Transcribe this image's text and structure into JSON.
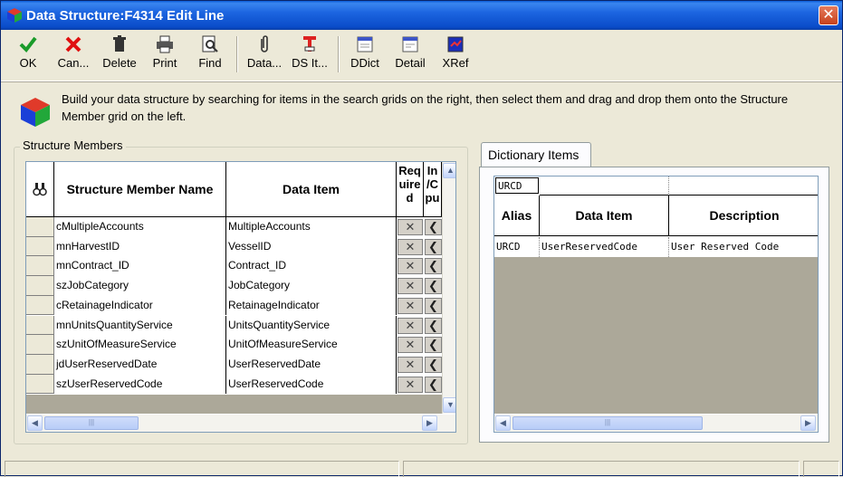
{
  "window": {
    "title": "Data Structure:F4314 Edit Line",
    "close_glyph": "✕"
  },
  "toolbar": {
    "ok": "OK",
    "cancel": "Can...",
    "delete": "Delete",
    "print": "Print",
    "find": "Find",
    "data": "Data...",
    "ds_item": "DS It...",
    "ddict": "DDict",
    "detail": "Detail",
    "xref": "XRef"
  },
  "info": {
    "message": "Build your data structure by searching for items in the search grids on the right, then select them and drag and drop them onto the Structure Member grid on the left."
  },
  "structure_members": {
    "group_label": "Structure Members",
    "headers": {
      "member_name": "Structure Member Name",
      "data_item": "Data Item",
      "required": "Req uire d",
      "io": "In /C pu"
    },
    "rows": [
      {
        "name": "cMultipleAccounts",
        "item": "MultipleAccounts"
      },
      {
        "name": "mnHarvestID",
        "item": "VesselID"
      },
      {
        "name": "mnContract_ID",
        "item": "Contract_ID"
      },
      {
        "name": "szJobCategory",
        "item": "JobCategory"
      },
      {
        "name": "cRetainageIndicator",
        "item": "RetainageIndicator"
      },
      {
        "name": "mnUnitsQuantityService",
        "item": "UnitsQuantityService"
      },
      {
        "name": "szUnitOfMeasureService",
        "item": "UnitOfMeasureService"
      },
      {
        "name": "jdUserReservedDate",
        "item": "UserReservedDate"
      },
      {
        "name": "szUserReservedCode",
        "item": "UserReservedCode"
      }
    ],
    "req_glyph": "✕"
  },
  "dictionary_items": {
    "tab_label": "Dictionary Items",
    "search_value": "URCD",
    "headers": {
      "alias": "Alias",
      "data_item": "Data Item",
      "description": "Description"
    },
    "rows": [
      {
        "alias": "URCD",
        "item": "UserReservedCode",
        "description": "User Reserved Code"
      }
    ]
  },
  "colors": {
    "title_bar": "#0a4cc9",
    "grid_gray": "#aca899"
  }
}
